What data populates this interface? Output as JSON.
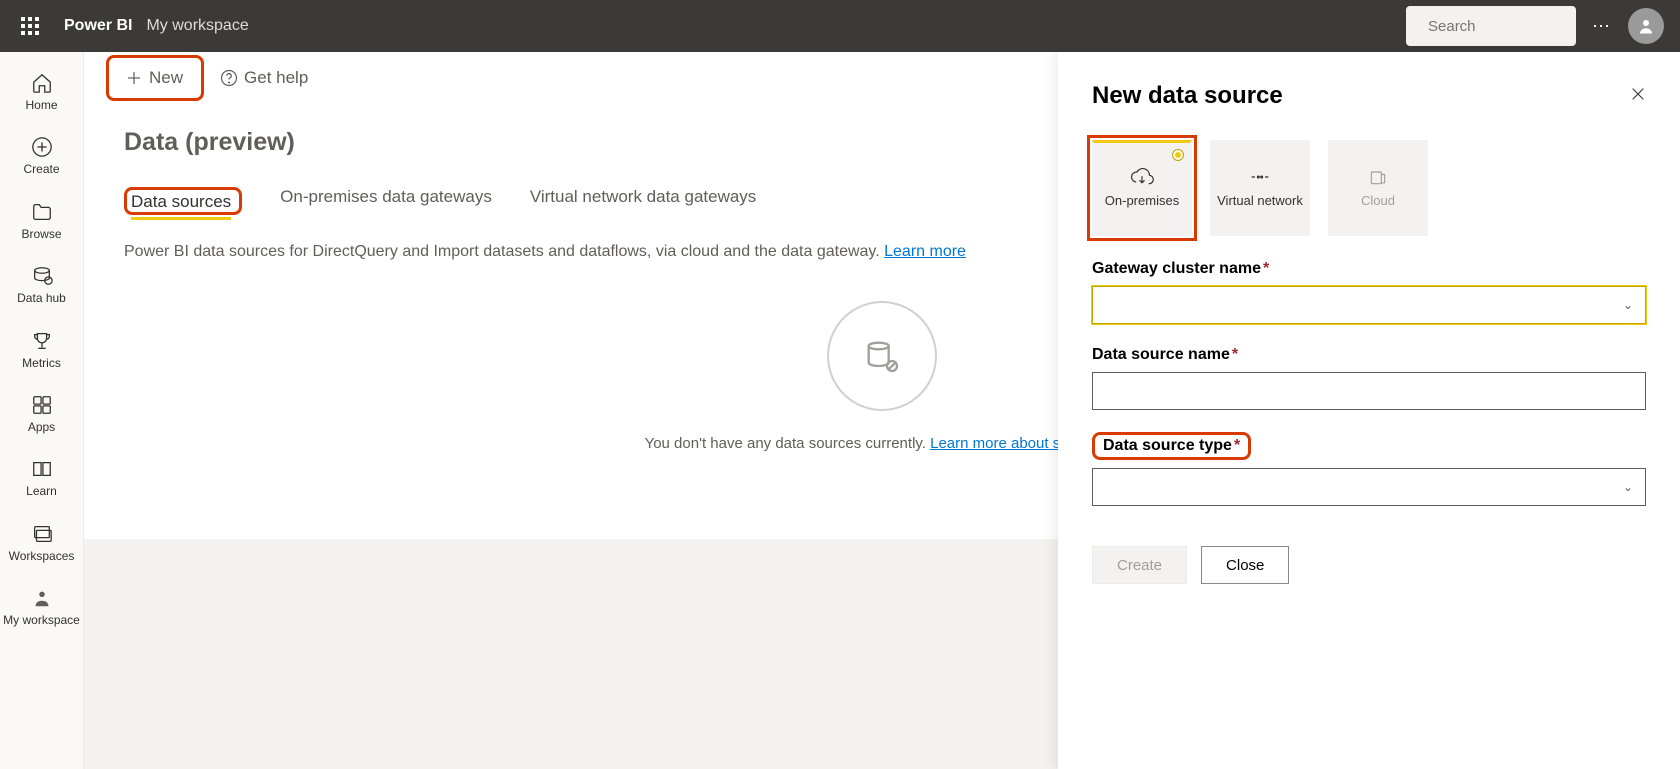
{
  "topbar": {
    "brand": "Power BI",
    "workspace": "My workspace",
    "search_placeholder": "Search"
  },
  "nav": {
    "home": "Home",
    "create": "Create",
    "browse": "Browse",
    "datahub": "Data hub",
    "metrics": "Metrics",
    "apps": "Apps",
    "learn": "Learn",
    "workspaces": "Workspaces",
    "myworkspace": "My workspace"
  },
  "actions": {
    "new": "New",
    "get_help": "Get help"
  },
  "page": {
    "title": "Data (preview)",
    "tabs": {
      "data_sources": "Data sources",
      "on_prem": "On-premises data gateways",
      "vnet": "Virtual network data gateways"
    },
    "description": "Power BI data sources for DirectQuery and Import datasets and dataflows, via cloud and the data gateway. ",
    "learn_more": "Learn more",
    "empty_text": "You don't have any data sources currently. ",
    "empty_link": "Learn more about supported"
  },
  "panel": {
    "title": "New data source",
    "types": {
      "onprem": "On-premises",
      "vnet": "Virtual network",
      "cloud": "Cloud"
    },
    "fields": {
      "gateway_cluster": "Gateway cluster name",
      "data_source_name": "Data source name",
      "data_source_type": "Data source type"
    },
    "buttons": {
      "create": "Create",
      "close": "Close"
    }
  }
}
